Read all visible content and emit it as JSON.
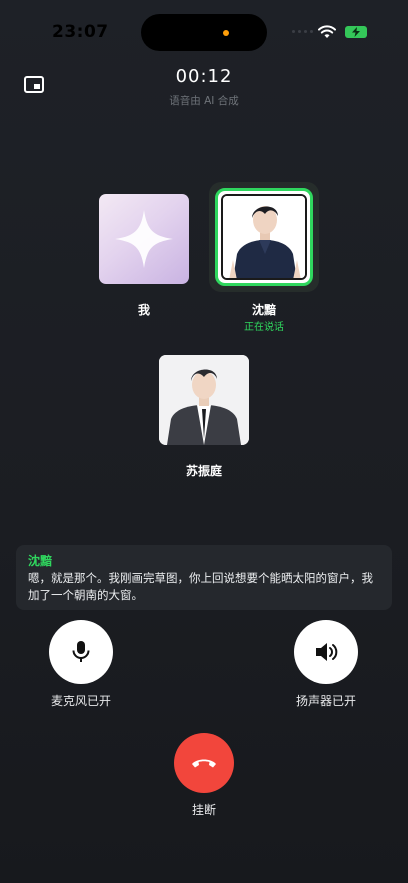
{
  "status_bar": {
    "time": "23:07"
  },
  "call": {
    "timer": "00:12",
    "subtitle": "语音由 AI 合成"
  },
  "participants": {
    "me": {
      "name": "我"
    },
    "speaker": {
      "name": "沈黯",
      "status": "正在说话"
    },
    "third": {
      "name": "苏振庭"
    }
  },
  "caption": {
    "speaker": "沈黯",
    "text": "嗯，就是那个。我刚画完草图，你上回说想要个能晒太阳的窗户，我加了一个朝南的大窗。"
  },
  "controls": {
    "mic_label": "麦克风已开",
    "speaker_label": "扬声器已开",
    "hangup_label": "挂断"
  },
  "colors": {
    "accent_green": "#2fd75e",
    "hangup_red": "#f2463c",
    "background": "#1d1f24"
  },
  "icons": [
    "pip-icon",
    "sparkle-icon",
    "mic-icon",
    "speaker-icon",
    "hangup-icon",
    "wifi-icon",
    "battery-icon"
  ]
}
